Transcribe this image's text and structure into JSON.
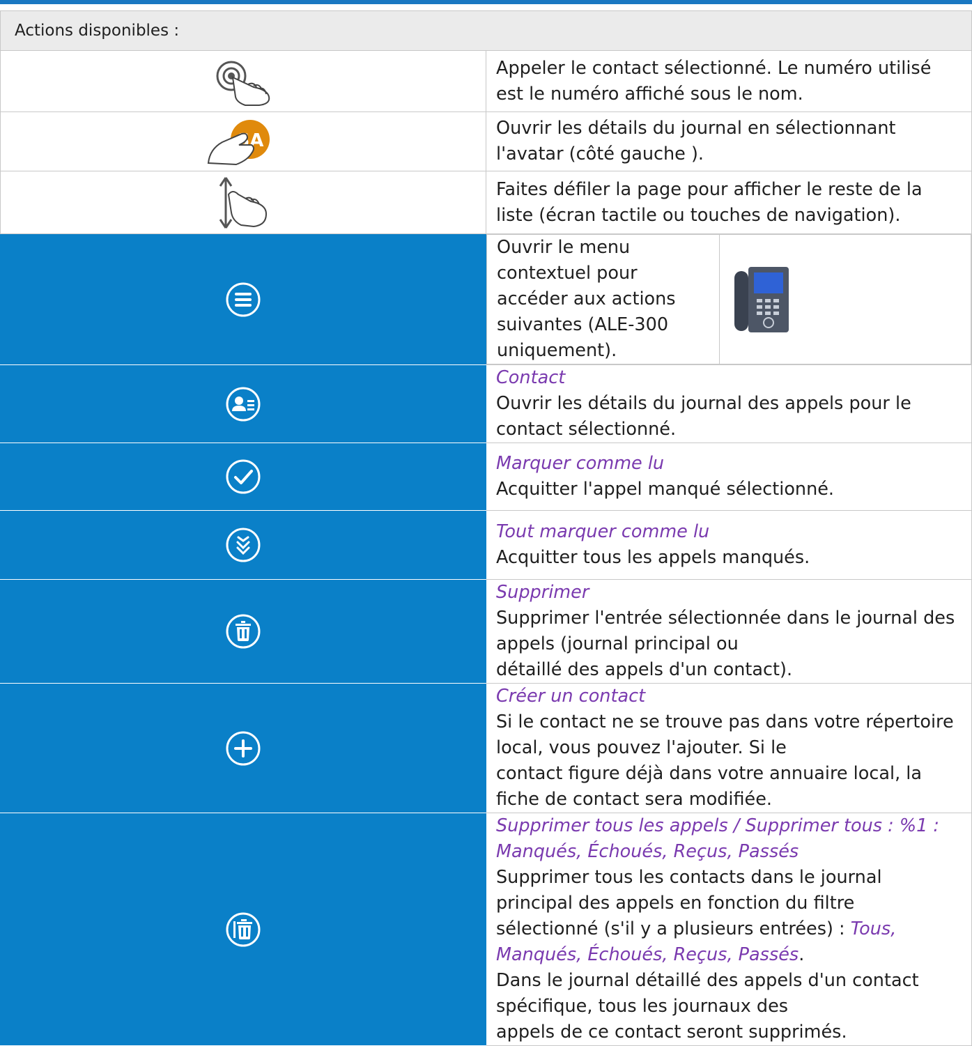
{
  "header": {
    "label": "Actions disponibles :"
  },
  "rows": [
    {
      "icon": "tap-call-icon",
      "text": "Appeler le contact sélectionné. Le numéro utilisé est le numéro affiché sous le nom."
    },
    {
      "icon": "avatar-tap-icon",
      "avatar_initials": "SA",
      "text": "Ouvrir les détails du journal en sélectionnant l'avatar (côté gauche )."
    },
    {
      "icon": "scroll-gesture-icon",
      "text": "Faites défiler la page pour afficher le reste de la liste (écran tactile ou touches de navigation)."
    },
    {
      "icon": "menu-icon",
      "text_line1": "Ouvrir le menu contextuel pour accéder aux actions",
      "text_line2": "suivantes (ALE-300 uniquement).",
      "side_image": "desk-phone-icon"
    },
    {
      "icon": "contact-card-icon",
      "title": "Contact",
      "text": "Ouvrir les détails du journal des appels pour le contact sélectionné."
    },
    {
      "icon": "check-circle-icon",
      "title": "Marquer comme lu",
      "text": "Acquitter l'appel manqué sélectionné."
    },
    {
      "icon": "double-check-icon",
      "title": "Tout marquer comme lu",
      "text": "Acquitter tous les appels manqués."
    },
    {
      "icon": "trash-icon",
      "title": "Supprimer",
      "text_line1": "Supprimer l'entrée sélectionnée dans le journal des appels (journal principal ou",
      "text_line2": "détaillé des appels d'un contact)."
    },
    {
      "icon": "plus-circle-icon",
      "title": "Créer un contact",
      "text_line1": "Si le contact ne se trouve pas dans votre répertoire local, vous pouvez l'ajouter. Si le",
      "text_line2": "contact figure déjà dans votre annuaire local, la fiche de contact sera modifiée."
    },
    {
      "icon": "trash-all-icon",
      "title": "Supprimer tous les appels / Supprimer tous : %1 : Manqués, Échoués, Reçus, Passés",
      "text_line1": "Supprimer tous les contacts dans le journal principal des appels en fonction du filtre",
      "text_line2_start": "sélectionné (s'il y a plusieurs entrées) : ",
      "text_line2_em": "Tous, Manqués, Échoués, Reçus, Passés",
      "text_line2_end": ".",
      "text_line3": "Dans le journal détaillé des appels d'un contact spécifique, tous les journaux des",
      "text_line4": "appels de ce contact seront supprimés."
    }
  ],
  "colors": {
    "accent_blue": "#0a80c8",
    "title_purple": "#7a3aaf",
    "avatar_orange": "#e08a0c"
  }
}
